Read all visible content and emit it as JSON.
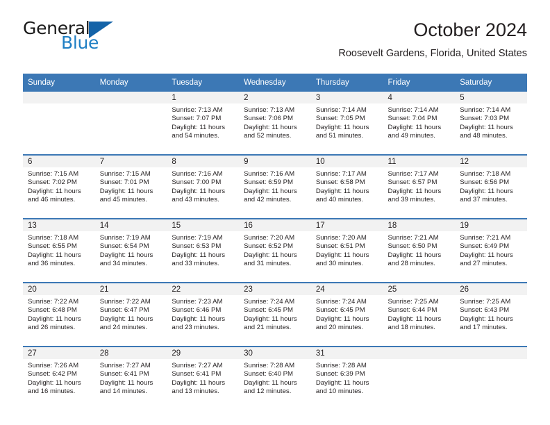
{
  "brand": {
    "name_top": "General",
    "name_bottom": "Blue",
    "triangle_icon": "triangle-icon",
    "color_dark": "#1a1a1a",
    "color_blue": "#1f7fc4"
  },
  "header": {
    "title": "October 2024",
    "location": "Roosevelt Gardens, Florida, United States"
  },
  "theme": {
    "header_blue": "#3c78b5",
    "band_gray": "#f2f2f2",
    "text": "#231f20"
  },
  "weekdays": [
    "Sunday",
    "Monday",
    "Tuesday",
    "Wednesday",
    "Thursday",
    "Friday",
    "Saturday"
  ],
  "weeks": [
    [
      {
        "day": "",
        "lines": []
      },
      {
        "day": "",
        "lines": []
      },
      {
        "day": "1",
        "lines": [
          "Sunrise: 7:13 AM",
          "Sunset: 7:07 PM",
          "Daylight: 11 hours",
          "and 54 minutes."
        ]
      },
      {
        "day": "2",
        "lines": [
          "Sunrise: 7:13 AM",
          "Sunset: 7:06 PM",
          "Daylight: 11 hours",
          "and 52 minutes."
        ]
      },
      {
        "day": "3",
        "lines": [
          "Sunrise: 7:14 AM",
          "Sunset: 7:05 PM",
          "Daylight: 11 hours",
          "and 51 minutes."
        ]
      },
      {
        "day": "4",
        "lines": [
          "Sunrise: 7:14 AM",
          "Sunset: 7:04 PM",
          "Daylight: 11 hours",
          "and 49 minutes."
        ]
      },
      {
        "day": "5",
        "lines": [
          "Sunrise: 7:14 AM",
          "Sunset: 7:03 PM",
          "Daylight: 11 hours",
          "and 48 minutes."
        ]
      }
    ],
    [
      {
        "day": "6",
        "lines": [
          "Sunrise: 7:15 AM",
          "Sunset: 7:02 PM",
          "Daylight: 11 hours",
          "and 46 minutes."
        ]
      },
      {
        "day": "7",
        "lines": [
          "Sunrise: 7:15 AM",
          "Sunset: 7:01 PM",
          "Daylight: 11 hours",
          "and 45 minutes."
        ]
      },
      {
        "day": "8",
        "lines": [
          "Sunrise: 7:16 AM",
          "Sunset: 7:00 PM",
          "Daylight: 11 hours",
          "and 43 minutes."
        ]
      },
      {
        "day": "9",
        "lines": [
          "Sunrise: 7:16 AM",
          "Sunset: 6:59 PM",
          "Daylight: 11 hours",
          "and 42 minutes."
        ]
      },
      {
        "day": "10",
        "lines": [
          "Sunrise: 7:17 AM",
          "Sunset: 6:58 PM",
          "Daylight: 11 hours",
          "and 40 minutes."
        ]
      },
      {
        "day": "11",
        "lines": [
          "Sunrise: 7:17 AM",
          "Sunset: 6:57 PM",
          "Daylight: 11 hours",
          "and 39 minutes."
        ]
      },
      {
        "day": "12",
        "lines": [
          "Sunrise: 7:18 AM",
          "Sunset: 6:56 PM",
          "Daylight: 11 hours",
          "and 37 minutes."
        ]
      }
    ],
    [
      {
        "day": "13",
        "lines": [
          "Sunrise: 7:18 AM",
          "Sunset: 6:55 PM",
          "Daylight: 11 hours",
          "and 36 minutes."
        ]
      },
      {
        "day": "14",
        "lines": [
          "Sunrise: 7:19 AM",
          "Sunset: 6:54 PM",
          "Daylight: 11 hours",
          "and 34 minutes."
        ]
      },
      {
        "day": "15",
        "lines": [
          "Sunrise: 7:19 AM",
          "Sunset: 6:53 PM",
          "Daylight: 11 hours",
          "and 33 minutes."
        ]
      },
      {
        "day": "16",
        "lines": [
          "Sunrise: 7:20 AM",
          "Sunset: 6:52 PM",
          "Daylight: 11 hours",
          "and 31 minutes."
        ]
      },
      {
        "day": "17",
        "lines": [
          "Sunrise: 7:20 AM",
          "Sunset: 6:51 PM",
          "Daylight: 11 hours",
          "and 30 minutes."
        ]
      },
      {
        "day": "18",
        "lines": [
          "Sunrise: 7:21 AM",
          "Sunset: 6:50 PM",
          "Daylight: 11 hours",
          "and 28 minutes."
        ]
      },
      {
        "day": "19",
        "lines": [
          "Sunrise: 7:21 AM",
          "Sunset: 6:49 PM",
          "Daylight: 11 hours",
          "and 27 minutes."
        ]
      }
    ],
    [
      {
        "day": "20",
        "lines": [
          "Sunrise: 7:22 AM",
          "Sunset: 6:48 PM",
          "Daylight: 11 hours",
          "and 26 minutes."
        ]
      },
      {
        "day": "21",
        "lines": [
          "Sunrise: 7:22 AM",
          "Sunset: 6:47 PM",
          "Daylight: 11 hours",
          "and 24 minutes."
        ]
      },
      {
        "day": "22",
        "lines": [
          "Sunrise: 7:23 AM",
          "Sunset: 6:46 PM",
          "Daylight: 11 hours",
          "and 23 minutes."
        ]
      },
      {
        "day": "23",
        "lines": [
          "Sunrise: 7:24 AM",
          "Sunset: 6:45 PM",
          "Daylight: 11 hours",
          "and 21 minutes."
        ]
      },
      {
        "day": "24",
        "lines": [
          "Sunrise: 7:24 AM",
          "Sunset: 6:45 PM",
          "Daylight: 11 hours",
          "and 20 minutes."
        ]
      },
      {
        "day": "25",
        "lines": [
          "Sunrise: 7:25 AM",
          "Sunset: 6:44 PM",
          "Daylight: 11 hours",
          "and 18 minutes."
        ]
      },
      {
        "day": "26",
        "lines": [
          "Sunrise: 7:25 AM",
          "Sunset: 6:43 PM",
          "Daylight: 11 hours",
          "and 17 minutes."
        ]
      }
    ],
    [
      {
        "day": "27",
        "lines": [
          "Sunrise: 7:26 AM",
          "Sunset: 6:42 PM",
          "Daylight: 11 hours",
          "and 16 minutes."
        ]
      },
      {
        "day": "28",
        "lines": [
          "Sunrise: 7:27 AM",
          "Sunset: 6:41 PM",
          "Daylight: 11 hours",
          "and 14 minutes."
        ]
      },
      {
        "day": "29",
        "lines": [
          "Sunrise: 7:27 AM",
          "Sunset: 6:41 PM",
          "Daylight: 11 hours",
          "and 13 minutes."
        ]
      },
      {
        "day": "30",
        "lines": [
          "Sunrise: 7:28 AM",
          "Sunset: 6:40 PM",
          "Daylight: 11 hours",
          "and 12 minutes."
        ]
      },
      {
        "day": "31",
        "lines": [
          "Sunrise: 7:28 AM",
          "Sunset: 6:39 PM",
          "Daylight: 11 hours",
          "and 10 minutes."
        ]
      },
      {
        "day": "",
        "lines": []
      },
      {
        "day": "",
        "lines": []
      }
    ]
  ]
}
